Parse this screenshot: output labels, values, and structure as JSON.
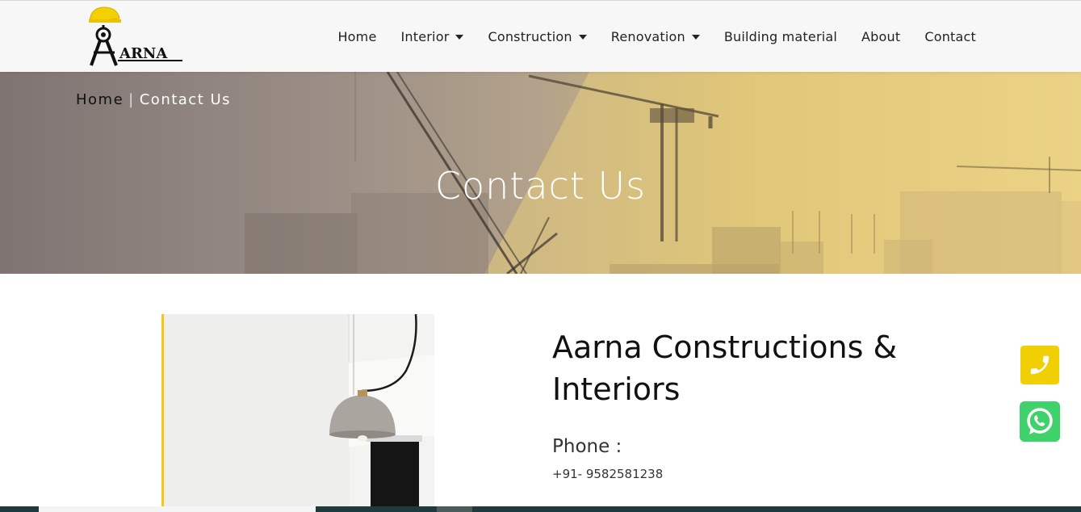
{
  "brand": {
    "logo_text": "ARNA",
    "logo_letter": "A"
  },
  "nav": {
    "items": [
      {
        "label": "Home",
        "dropdown": false
      },
      {
        "label": "Interior",
        "dropdown": true
      },
      {
        "label": "Construction",
        "dropdown": true
      },
      {
        "label": "Renovation",
        "dropdown": true
      },
      {
        "label": "Building material",
        "dropdown": false
      },
      {
        "label": "About",
        "dropdown": false
      },
      {
        "label": "Contact",
        "dropdown": false
      }
    ]
  },
  "breadcrumb": {
    "home": "Home",
    "separator": "|",
    "current": "Contact Us"
  },
  "hero": {
    "title": "Contact Us"
  },
  "contact": {
    "company": "Aarna Constructions & Interiors",
    "phone_label": "Phone :",
    "phone_value": "+91- 9582581238"
  },
  "floating": {
    "phone_icon": "phone-icon",
    "whatsapp_icon": "whatsapp-icon"
  },
  "colors": {
    "accent": "#f0cf04",
    "whatsapp": "#3fd16a",
    "navbar_bg": "#f7f7f8",
    "hero_gold": "#efd791"
  }
}
